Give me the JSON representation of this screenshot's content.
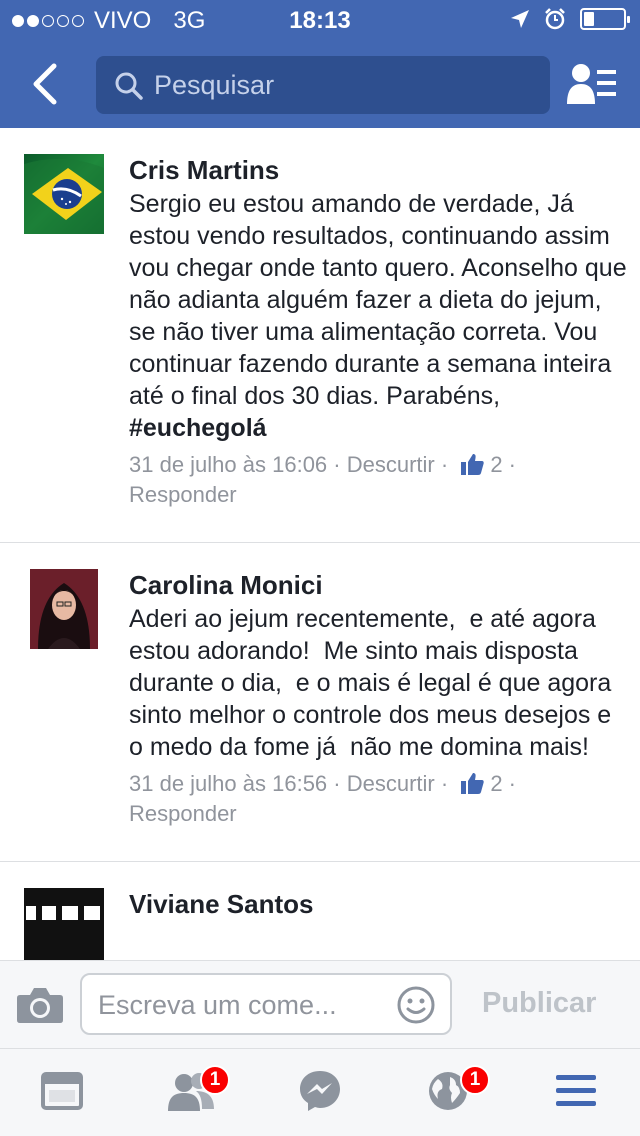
{
  "status_bar": {
    "carrier": "VIVO",
    "network": "3G",
    "time": "18:13",
    "signal_bars": 2,
    "battery_level": 0.25
  },
  "nav": {
    "search_placeholder": "Pesquisar",
    "back_icon": "chevron-left-icon",
    "friends_icon": "friend-list-icon"
  },
  "comments": [
    {
      "author": "Cris Martins",
      "text": "Sergio eu estou amando de verdade, Já estou vendo resultados, continuando assim vou chegar onde tanto quero. Aconselho que não adianta alguém fazer a dieta do jejum, se não tiver uma alimentação correta. Vou continuar fazendo durante a semana inteira até o final dos 30 dias. Parabéns, ",
      "hashtag": "#euchegolá",
      "timestamp": "31 de julho às 16:06",
      "unlike": "Descurtir",
      "likes": "2",
      "reply": "Responder",
      "avatar": "brazil-flag-avatar"
    },
    {
      "author": "Carolina Monici",
      "text": "Aderi ao jejum recentemente,  e até agora estou adorando!  Me sinto mais disposta durante o dia,  e o mais é legal é que agora sinto melhor o controle dos meus desejos e o medo da fome já  não me domina mais!",
      "timestamp": "31 de julho às 16:56",
      "unlike": "Descurtir",
      "likes": "2",
      "reply": "Responder",
      "avatar": "profile-photo-avatar"
    },
    {
      "author": "Viviane Santos",
      "avatar": "black-avatar"
    }
  ],
  "composer": {
    "placeholder": "Escreva um come...",
    "publish_label": "Publicar"
  },
  "tabbar": {
    "friends_badge": "1",
    "notifications_badge": "1"
  },
  "colors": {
    "brand_blue": "#4267b2",
    "search_bg": "#2e4f8f",
    "meta_gray": "#90949c",
    "badge_red": "#fa0000"
  }
}
